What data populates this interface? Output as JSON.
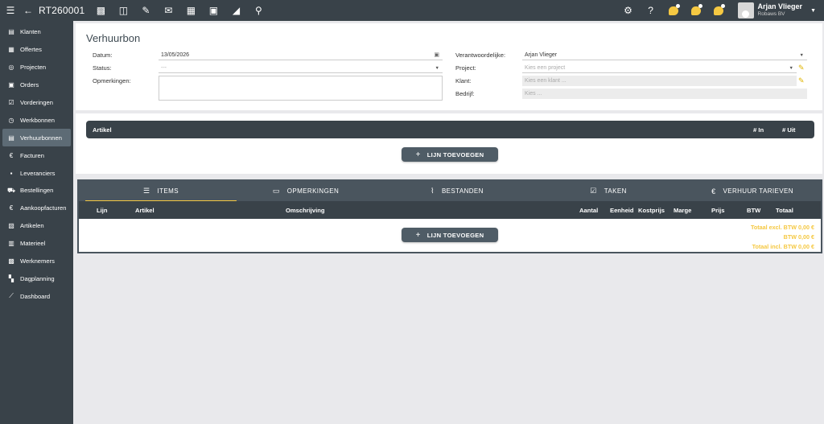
{
  "topbar": {
    "doc_title": "RT260001",
    "icons": [
      "menu-icon",
      "back-arrow-icon",
      "pdf-icon",
      "print-preview-icon",
      "edit-pencil-icon",
      "mail-icon",
      "trash-icon",
      "archive-icon",
      "lock-icon",
      "search-icon"
    ],
    "right_icons": [
      "gear-icon",
      "help-icon",
      "chat-notification-icon",
      "message-notification-icon",
      "message-notification-icon"
    ]
  },
  "user": {
    "name": "Arjan Vlieger",
    "company": "Robaws BV"
  },
  "sidebar": {
    "items": [
      {
        "label": "Klanten",
        "icon": "clients-icon",
        "glyph": "▤"
      },
      {
        "label": "Offertes",
        "icon": "quotes-icon",
        "glyph": "▦"
      },
      {
        "label": "Projecten",
        "icon": "projects-icon",
        "glyph": "◎"
      },
      {
        "label": "Orders",
        "icon": "orders-icon",
        "glyph": "▣"
      },
      {
        "label": "Vorderingen",
        "icon": "progress-icon",
        "glyph": "☑"
      },
      {
        "label": "Werkbonnen",
        "icon": "work-orders-icon",
        "glyph": "◷"
      },
      {
        "label": "Verhuurbonnen",
        "icon": "rental-icon",
        "glyph": "▤"
      },
      {
        "label": "Facturen",
        "icon": "invoices-icon",
        "glyph": "€"
      },
      {
        "label": "Leveranciers",
        "icon": "suppliers-icon",
        "glyph": "▪"
      },
      {
        "label": "Bestellingen",
        "icon": "cart-icon",
        "glyph": "⛟"
      },
      {
        "label": "Aankoopfacturen",
        "icon": "purchase-invoices-icon",
        "glyph": "€"
      },
      {
        "label": "Artikelen",
        "icon": "articles-icon",
        "glyph": "▧"
      },
      {
        "label": "Materieel",
        "icon": "equipment-icon",
        "glyph": "▥"
      },
      {
        "label": "Werknemers",
        "icon": "employees-icon",
        "glyph": "▩"
      },
      {
        "label": "Dagplanning",
        "icon": "planning-icon",
        "glyph": "▚"
      },
      {
        "label": "Dashboard",
        "icon": "dashboard-icon",
        "glyph": "⟋"
      }
    ],
    "active_index": 6
  },
  "form": {
    "title": "Verhuurbon",
    "datum_label": "Datum:",
    "datum_value": "13/05/2026",
    "status_label": "Status:",
    "status_value": "---",
    "opmerkingen_label": "Opmerkingen:",
    "verantwoordelijke_label": "Verantwoordelijke:",
    "verantwoordelijke_value": "Arjan Vlieger",
    "project_label": "Project:",
    "project_placeholder": "Kies een project",
    "klant_label": "Klant:",
    "klant_placeholder": "Kies een klant ...",
    "bedrijf_label": "Bedrijf:",
    "bedrijf_placeholder": "Kies ..."
  },
  "article_section": {
    "col_artikel": "Artikel",
    "col_in": "# In",
    "col_uit": "# Uit",
    "add_button": "LIJN TOEVOEGEN"
  },
  "tabs": [
    {
      "label": "ITEMS",
      "icon": "list-icon",
      "glyph": "☰"
    },
    {
      "label": "OPMERKINGEN",
      "icon": "comment-icon",
      "glyph": "▭"
    },
    {
      "label": "BESTANDEN",
      "icon": "paperclip-icon",
      "glyph": "⌇"
    },
    {
      "label": "TAKEN",
      "icon": "checkbox-icon",
      "glyph": "☑"
    },
    {
      "label": "VERHUUR TARIEVEN",
      "icon": "euro-icon",
      "glyph": "€"
    }
  ],
  "items_table": {
    "columns": [
      "Lijn",
      "Artikel",
      "Omschrijving",
      "Aantal",
      "Eenheid",
      "Kostprijs",
      "Marge",
      "Prijs",
      "BTW",
      "Totaal"
    ],
    "add_button": "LIJN TOEVOEGEN",
    "total_excl": "Totaal excl. BTW 0,00 €",
    "btw": "BTW 0,00 €",
    "total_incl": "Totaal incl. BTW 0,00 €"
  },
  "colors": {
    "dark": "#394249",
    "accent": "#f5c842"
  }
}
